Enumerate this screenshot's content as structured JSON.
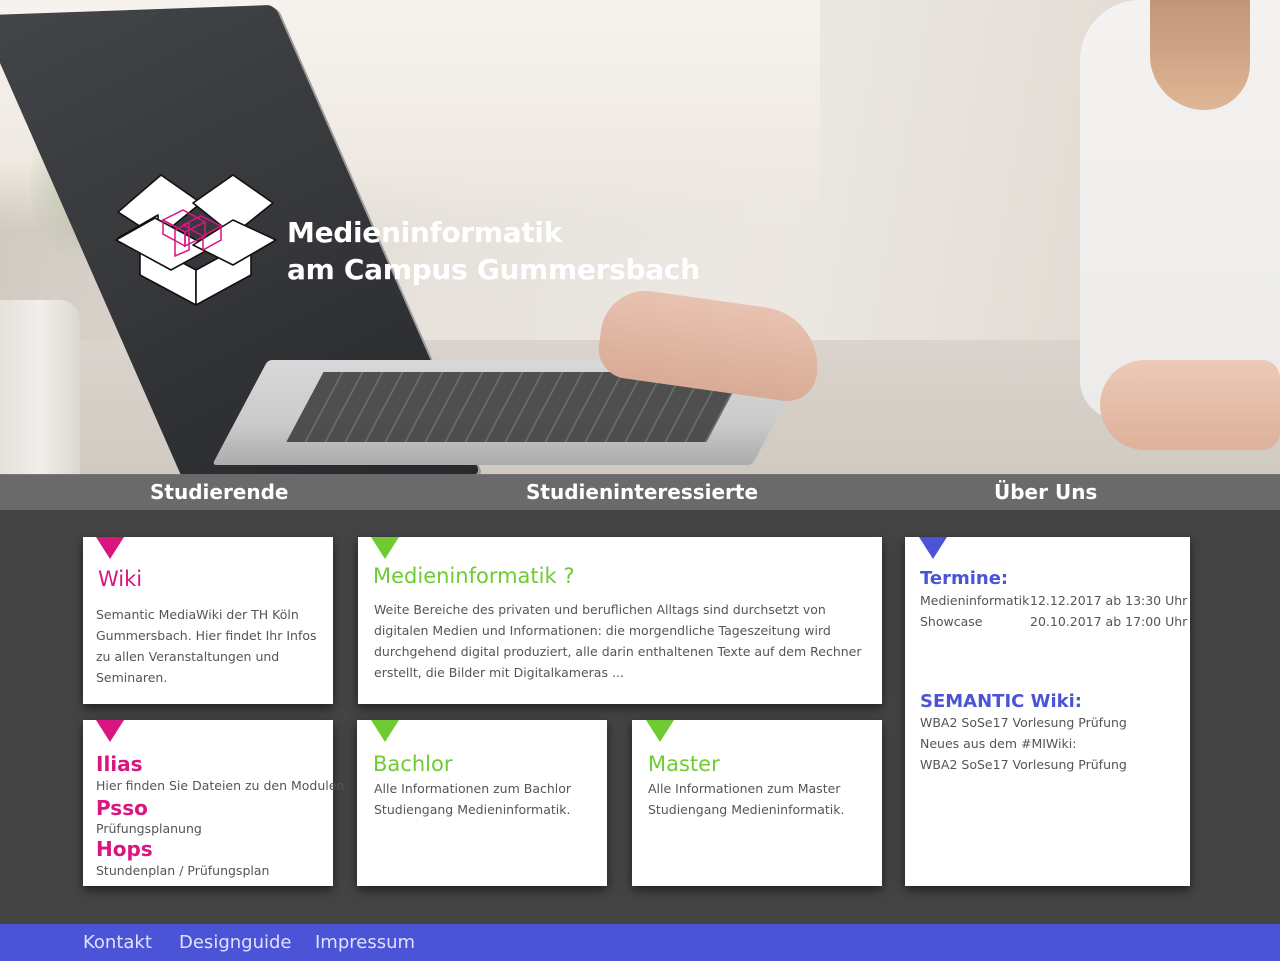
{
  "brand": {
    "title_line1": "Medieninformatik",
    "title_line2": "am Campus Gummersbach",
    "logo_icon": "open-box-logo",
    "accent_pink": "#d9157f",
    "accent_green": "#6fcb32",
    "accent_blue": "#4b54d6"
  },
  "nav": {
    "items": [
      {
        "label": "Studierende"
      },
      {
        "label": "Studieninteressierte"
      },
      {
        "label": "Über Uns"
      }
    ]
  },
  "cards": {
    "wiki": {
      "title": "Wiki",
      "text": "Semantic MediaWiki der TH Köln Gummersbach. Hier findet Ihr Infos zu allen Veranstaltungen und Seminaren."
    },
    "medieninformatik": {
      "title": "Medieninformatik ?",
      "text": "Weite Bereiche des privaten und beruflichen Alltags sind durchsetzt von digitalen Medien und Informationen: die morgendliche Tageszeitung wird durchgehend digital produziert, alle darin enthaltenen Texte auf dem Rechner erstellt, die Bilder mit Digitalkameras ..."
    },
    "termine": {
      "title": "Termine:",
      "rows": [
        {
          "name": "Medieninformatik",
          "date": "12.12.2017 ab 13:30 Uhr"
        },
        {
          "name": "Showcase",
          "date": "20.10.2017 ab 17:00 Uhr"
        }
      ],
      "semantic_title": "SEMANTIC Wiki:",
      "semantic_lines": [
        "WBA2 SoSe17 Vorlesung Prüfung",
        "Neues aus dem #MIWiki:",
        "WBA2 SoSe17 Vorlesung Prüfung"
      ]
    },
    "tools": {
      "ilias_title": "Ilias",
      "ilias_text": "Hier finden Sie Dateien zu den Modulen",
      "psso_title": "Psso",
      "psso_text": "Prüfungsplanung",
      "hops_title": "Hops",
      "hops_text": "Stundenplan / Prüfungsplan"
    },
    "bachlor": {
      "title": "Bachlor",
      "text": "Alle Informationen zum Bachlor Studiengang Medieninformatik."
    },
    "master": {
      "title": "Master",
      "text": "Alle Informationen zum Master Studiengang Medieninformatik."
    }
  },
  "footer": {
    "links": [
      {
        "label": "Kontakt"
      },
      {
        "label": "Designguide"
      },
      {
        "label": "Impressum"
      }
    ]
  }
}
